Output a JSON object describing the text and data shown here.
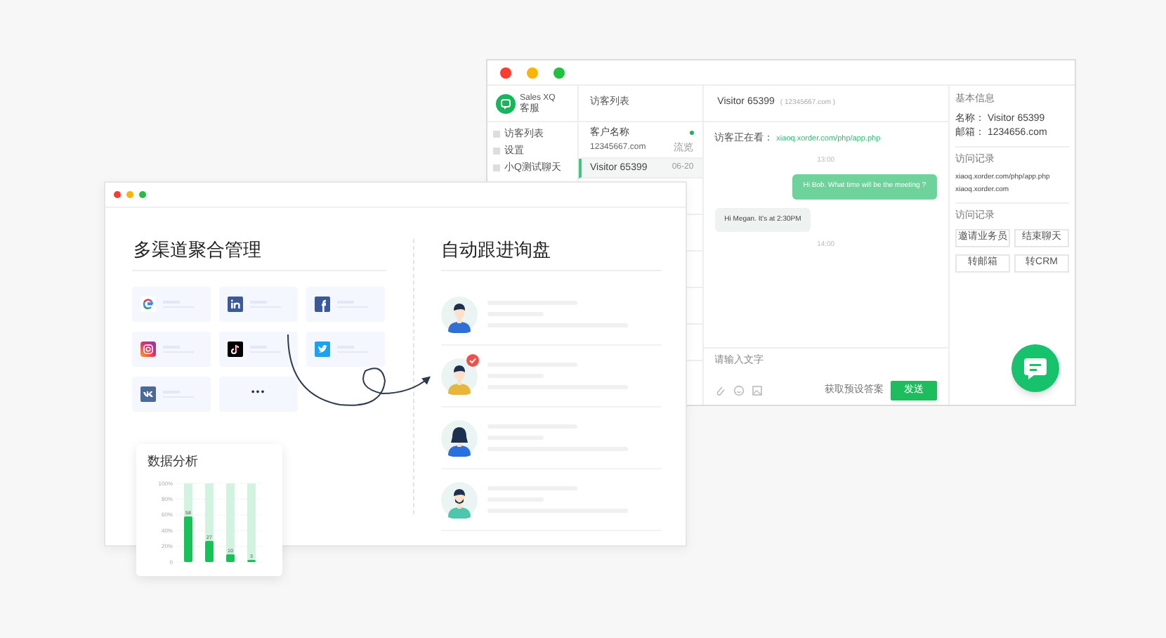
{
  "chat_window": {
    "brand": {
      "name": "Sales XQ",
      "subtitle": "客服"
    },
    "sidebar": {
      "items": [
        {
          "label": "访客列表",
          "selected": false
        },
        {
          "label": "设置",
          "selected": false
        },
        {
          "label": "小Q测试聊天",
          "selected": false
        }
      ]
    },
    "visitor_list": {
      "title": "访客列表",
      "items": [
        {
          "name": "客户名称",
          "detail": "12345667.com",
          "meta": "流览",
          "online": true,
          "selected": false
        },
        {
          "name": "Visitor 65399",
          "meta": "06-20",
          "online": false,
          "selected": true
        }
      ]
    },
    "conversation": {
      "title": "Visitor 65399",
      "subtitle": "( 12345667.com )",
      "viewing_label": "访客正在看：",
      "viewing_url": "xiaoq.xorder.com/php/app.php",
      "messages": [
        {
          "kind": "time",
          "text": "13:00"
        },
        {
          "kind": "sent",
          "text": "Hi Bob. What time will be the meeting ?"
        },
        {
          "kind": "received",
          "text": "Hi Megan. It's at 2:30PM"
        },
        {
          "kind": "time",
          "text": "14:00"
        }
      ],
      "input": {
        "placeholder": "请输入文字"
      },
      "preset_link": "获取预设答案",
      "send_button": "发送"
    },
    "info_panel": {
      "basic_title": "基本信息",
      "fields": [
        {
          "label": "名称：",
          "value": "Visitor 65399"
        },
        {
          "label": "邮箱：",
          "value": "1234656.com"
        }
      ],
      "visits_title": "访问记录",
      "visits": [
        "xiaoq.xorder.com/php/app.php",
        "xiaoq.xorder.com"
      ],
      "actions_title": "访问记录",
      "actions": [
        "邀请业务员",
        "结束聊天",
        "转邮箱",
        "转CRM"
      ]
    }
  },
  "feature_window": {
    "channels": {
      "title": "多渠道聚合管理",
      "items": [
        {
          "kind": "google"
        },
        {
          "kind": "linkedin"
        },
        {
          "kind": "facebook"
        },
        {
          "kind": "instagram"
        },
        {
          "kind": "tiktok"
        },
        {
          "kind": "twitter"
        },
        {
          "kind": "vk"
        },
        {
          "kind": "more",
          "text": "•••"
        }
      ]
    },
    "follow_up": {
      "title": "自动跟进询盘",
      "leads": [
        {
          "kind": "man",
          "followed": false
        },
        {
          "kind": "man-yellow",
          "followed": true
        },
        {
          "kind": "woman",
          "followed": false
        },
        {
          "kind": "bearded",
          "followed": false
        }
      ]
    }
  },
  "analytics_card": {
    "title": "数据分析",
    "chart_data": {
      "type": "bar",
      "values": [
        58,
        27,
        10,
        3
      ],
      "data_labels": true,
      "grid": true,
      "ylim": [
        0,
        100
      ],
      "yticks": [
        {
          "value": 0,
          "label": "0"
        },
        {
          "value": 20,
          "label": "20%"
        },
        {
          "value": 40,
          "label": "40%"
        },
        {
          "value": 60,
          "label": "60%"
        },
        {
          "value": 80,
          "label": "80%"
        },
        {
          "value": 100,
          "label": "100%"
        }
      ]
    }
  }
}
